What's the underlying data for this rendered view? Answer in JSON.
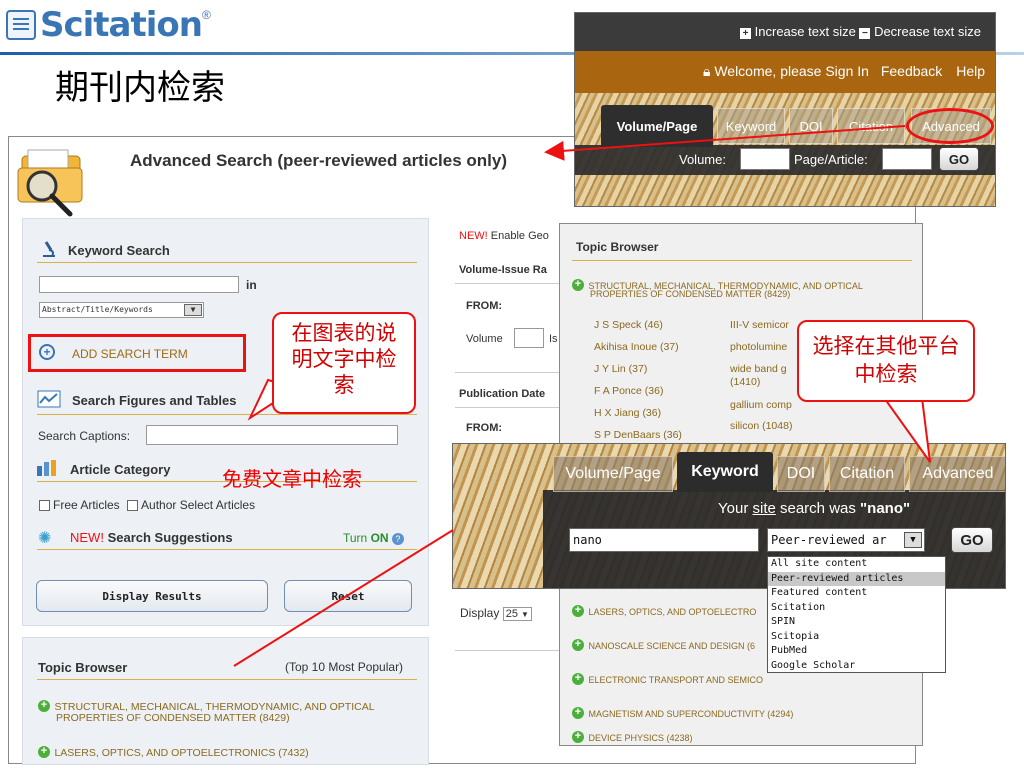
{
  "slide": {
    "logo": "Scitation",
    "logo_mark": "®",
    "title": "期刊内检索"
  },
  "advanced": {
    "header_title": "Advanced Search (peer-reviewed articles only)",
    "keyword_search": {
      "title": "Keyword Search",
      "in_label": "in",
      "field_select": "Abstract/Title/Keywords",
      "add_term": "ADD SEARCH TERM"
    },
    "figures": {
      "title": "Search Figures and Tables",
      "captions_label": "Search Captions:"
    },
    "category": {
      "title": "Article Category",
      "options": [
        "Free Articles",
        "Author Select Articles"
      ]
    },
    "suggestions": {
      "new": "NEW!",
      "title": "Search Suggestions",
      "turn": "Turn",
      "state": "ON"
    },
    "buttons": {
      "display": "Display Results",
      "reset": "Reset"
    },
    "topic_browser": {
      "title": "Topic Browser",
      "popular": "(Top 10 Most Popular)",
      "items": [
        "STRUCTURAL, MECHANICAL, THERMODYNAMIC, AND OPTICAL",
        "PROPERTIES OF CONDENSED MATTER (8429)",
        "LASERS, OPTICS, AND OPTOELECTRONICS (7432)"
      ]
    },
    "middle": {
      "new": "NEW!",
      "enable": "Enable Geo",
      "volume_issue": "Volume-Issue Ra",
      "from": "FROM:",
      "volume": "Volume",
      "issue": "Is",
      "pub_date": "Publication Date",
      "from2": "FROM:",
      "display": "Display",
      "display_value": "25"
    }
  },
  "toolbar": {
    "increase": "Increase text size",
    "decrease": "Decrease text size",
    "welcome": "Welcome, please Sign In",
    "feedback": "Feedback",
    "help": "Help",
    "tabs": [
      "Volume/Page",
      "Keyword",
      "DOI",
      "Citation",
      "Advanced"
    ],
    "volume_label": "Volume:",
    "page_label": "Page/Article:",
    "go": "GO"
  },
  "topic_overlay": {
    "title": "Topic Browser",
    "topic_line1": "STRUCTURAL, MECHANICAL, THERMODYNAMIC, AND OPTICAL",
    "topic_line2": "PROPERTIES OF CONDENSED MATTER (8429)",
    "authors": [
      "J S Speck (46)",
      "Akihisa Inoue (37)",
      "J Y Lin (37)",
      "F A Ponce (36)",
      "H X Jiang (36)",
      "S P DenBaars (36)"
    ],
    "subjects": [
      "III-V semicor",
      "photolumine",
      "wide band g",
      "(1410)",
      "gallium comp",
      "silicon (1048)"
    ],
    "bottom_topics": [
      "LASERS, OPTICS, AND OPTOELECTRO",
      "NANOSCALE SCIENCE AND DESIGN (6",
      "ELECTRONIC TRANSPORT AND SEMICO",
      "MAGNETISM AND SUPERCONDUCTIVITY (4294)",
      "DEVICE PHYSICS (4238)"
    ]
  },
  "keyword_overlay": {
    "tabs": [
      "Volume/Page",
      "Keyword",
      "DOI",
      "Citation",
      "Advanced"
    ],
    "search_was_prefix": "Your",
    "site": "site",
    "search_was_mid": "search was",
    "term": "\"nano\"",
    "input_value": "nano",
    "select_value": "Peer-reviewed ar",
    "go": "GO",
    "options": [
      "All site content",
      "Peer-reviewed articles",
      "Featured content",
      "Scitation",
      "SPIN",
      "Scitopia",
      "PubMed",
      "Google Scholar"
    ]
  },
  "callouts": {
    "captions": "在图表的说明文字中检索",
    "free": "免费文章中检索",
    "other": "选择在其他平台中检索"
  },
  "colors": {
    "accent_red": "#e11111",
    "brand_blue": "#3a76b6",
    "toolbar_brown": "#aa6511"
  }
}
